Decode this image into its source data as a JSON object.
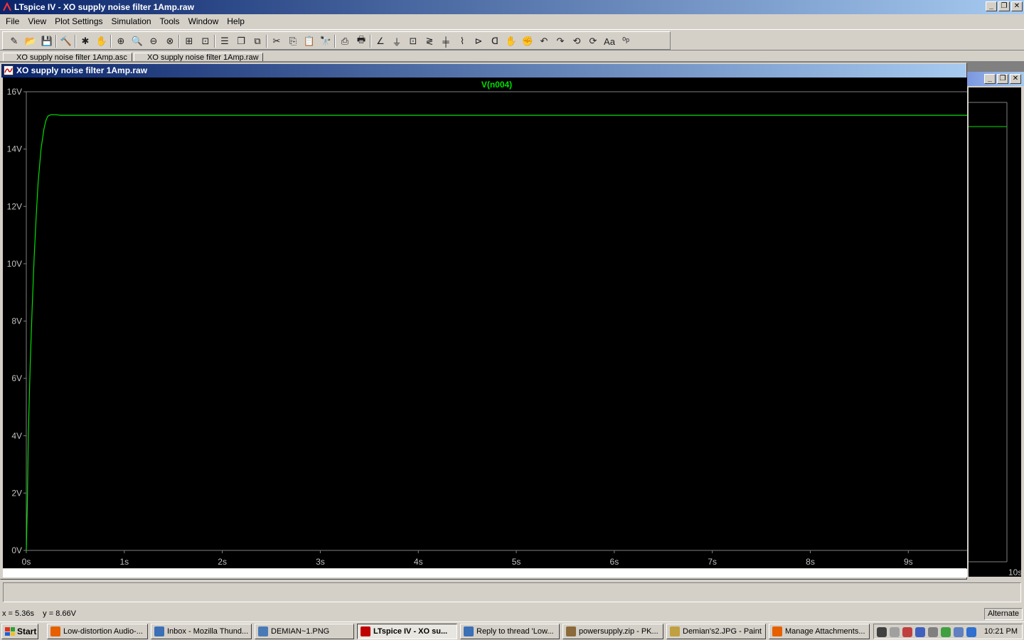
{
  "window": {
    "title": "LTspice IV - XO supply noise filter 1Amp.raw",
    "minimize_label": "_",
    "restore_label": "❐",
    "close_label": "✕"
  },
  "menu": [
    {
      "label": "File"
    },
    {
      "label": "View"
    },
    {
      "label": "Plot Settings"
    },
    {
      "label": "Simulation"
    },
    {
      "label": "Tools"
    },
    {
      "label": "Window"
    },
    {
      "label": "Help"
    }
  ],
  "toolbar": {
    "icons": [
      "new-schematic-icon",
      "open-icon",
      "save-icon",
      "control-panel-icon",
      "run-icon",
      "halt-icon",
      "zoom-in-icon",
      "zoom-full-icon",
      "zoom-out-icon",
      "zoom-cancel-icon",
      "autorange-icon",
      "mark-unconnected-icon",
      "tile-horizontal-icon",
      "cascade-icon",
      "tile-vertical-icon",
      "cut-icon",
      "copy-icon",
      "paste-icon",
      "find-icon",
      "print-preview-icon",
      "print-icon",
      "wire-icon",
      "ground-icon",
      "label-icon",
      "resistor-icon",
      "capacitor-icon",
      "inductor-icon",
      "diode-icon",
      "component-icon",
      "move-icon",
      "drag-icon",
      "undo-icon",
      "redo-icon",
      "rotate-icon",
      "mirror-icon",
      "text-icon",
      "spice-directive-icon"
    ]
  },
  "tabs": [
    {
      "label": "XO supply noise filter 1Amp.asc"
    },
    {
      "label": "XO supply noise filter 1Amp.raw"
    }
  ],
  "plot_window": {
    "title": "XO supply noise filter 1Amp.raw"
  },
  "back_window": {
    "x_end_label": "10s"
  },
  "chart_data": {
    "type": "line",
    "title": "",
    "series": [
      {
        "name": "V(n004)",
        "color": "#00e000",
        "x": [
          0,
          0.01,
          0.02,
          0.04,
          0.06,
          0.08,
          0.1,
          0.12,
          0.15,
          0.18,
          0.2,
          0.22,
          0.25,
          0.3,
          0.35,
          1,
          2,
          3,
          4,
          5,
          6,
          7,
          8,
          9,
          9.6
        ],
        "y": [
          0,
          1.5,
          4.0,
          6.5,
          8.5,
          10.2,
          11.6,
          12.8,
          14.0,
          14.7,
          15.0,
          15.15,
          15.2,
          15.2,
          15.18,
          15.18,
          15.18,
          15.18,
          15.18,
          15.18,
          15.18,
          15.18,
          15.18,
          15.18,
          15.18
        ]
      }
    ],
    "x_ticks": [
      "0s",
      "1s",
      "2s",
      "3s",
      "4s",
      "5s",
      "6s",
      "7s",
      "8s",
      "9s"
    ],
    "y_ticks": [
      "0V",
      "2V",
      "4V",
      "6V",
      "8V",
      "10V",
      "12V",
      "14V",
      "16V"
    ],
    "xlim": [
      0,
      9.6
    ],
    "ylim": [
      0,
      16
    ],
    "grid": false,
    "background": "#000000",
    "axis_color": "#808080"
  },
  "status": {
    "cursor": "x = 5.36s    y = 8.66V",
    "mode": "Alternate"
  },
  "taskbar": {
    "start_label": "Start",
    "tasks": [
      {
        "label": "Low-distortion Audio-...",
        "icon_color": "#e66000"
      },
      {
        "label": "Inbox - Mozilla Thund...",
        "icon_color": "#3b6fb6"
      },
      {
        "label": "DEMIAN~1.PNG",
        "icon_color": "#4a7ab5"
      },
      {
        "label": "LTspice IV - XO su...",
        "icon_color": "#c00000",
        "active": true
      },
      {
        "label": "Reply to thread 'Low...",
        "icon_color": "#3b6fb6"
      },
      {
        "label": "powersupply.zip - PK...",
        "icon_color": "#8a6a3a"
      },
      {
        "label": "Demian's2.JPG - Paint",
        "icon_color": "#c0a040"
      },
      {
        "label": "Manage Attachments...",
        "icon_color": "#e66000"
      }
    ],
    "clock": "10:21 PM"
  }
}
